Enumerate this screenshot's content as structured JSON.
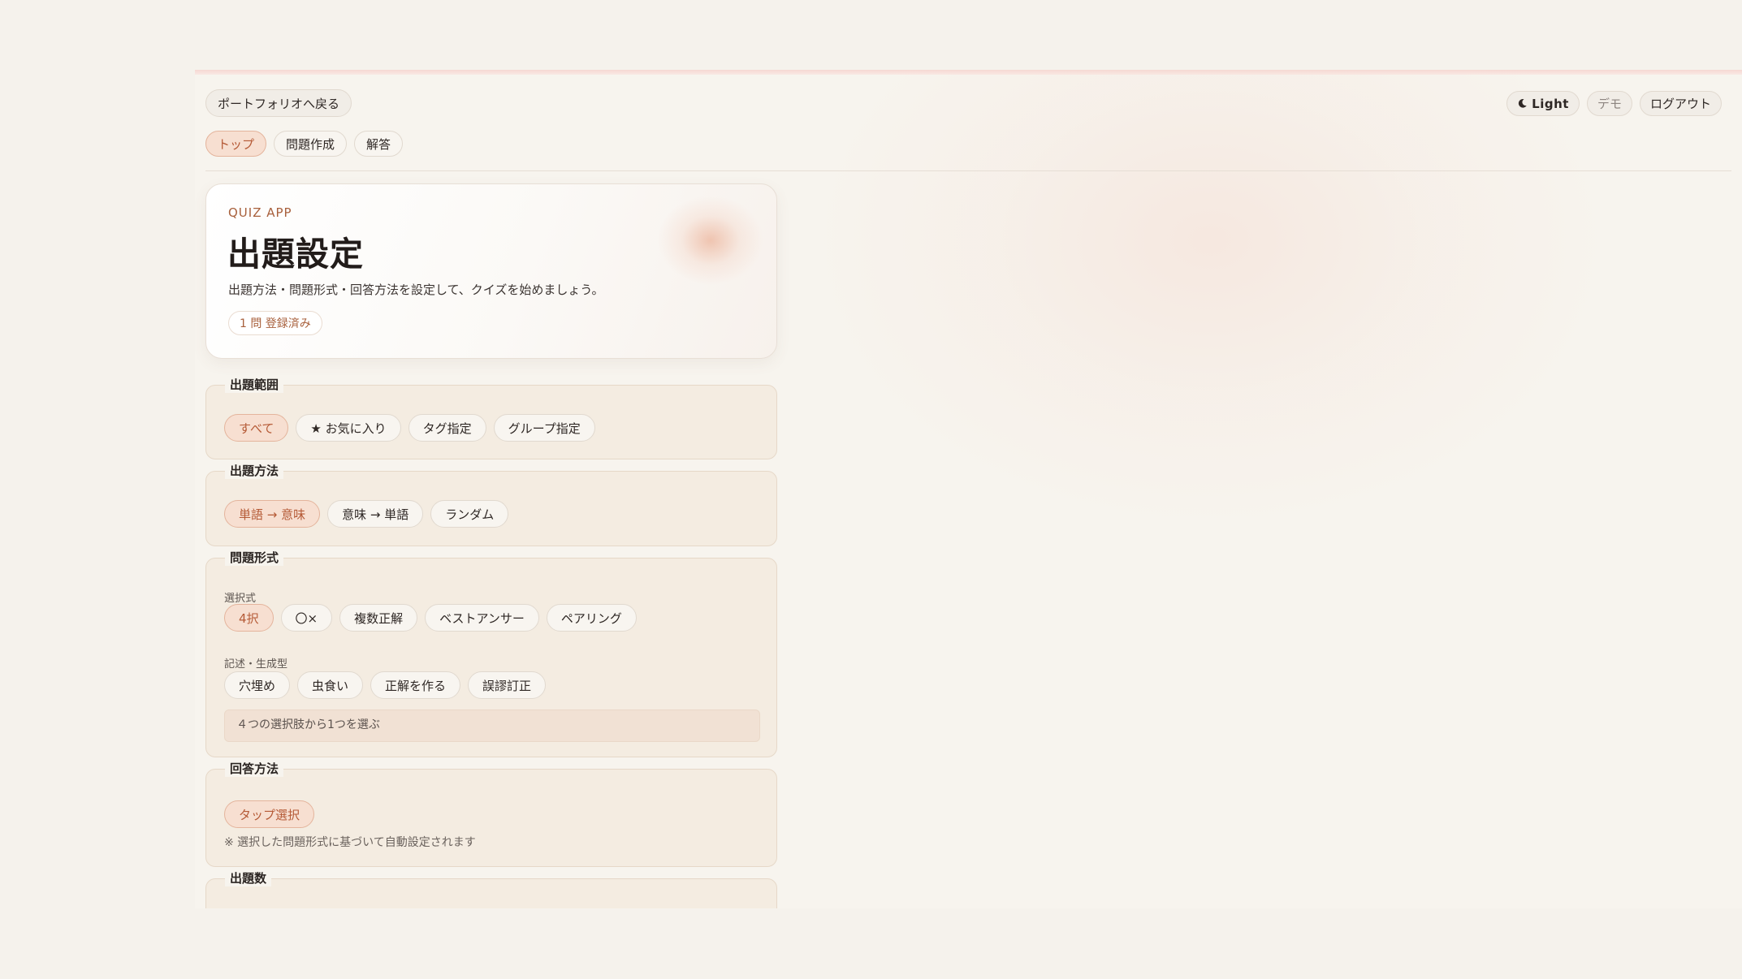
{
  "header": {
    "back_label": "ポートフォリオへ戻る",
    "theme_label": "Light",
    "theme_icon": "moon-icon",
    "demo_label": "デモ",
    "logout_label": "ログアウト"
  },
  "nav": {
    "tabs": [
      {
        "label": "トップ",
        "active": true
      },
      {
        "label": "問題作成",
        "active": false
      },
      {
        "label": "解答",
        "active": false
      }
    ]
  },
  "hero": {
    "eyebrow": "QUIZ APP",
    "title": "出題設定",
    "description": "出題方法・問題形式・回答方法を設定して、クイズを始めましょう。",
    "count_badge": "1 問 登録済み"
  },
  "scope": {
    "legend": "出題範囲",
    "options": [
      {
        "label": "すべて",
        "active": true
      },
      {
        "label": "★ お気に入り",
        "active": false
      },
      {
        "label": "タグ指定",
        "active": false
      },
      {
        "label": "グループ指定",
        "active": false
      }
    ]
  },
  "method": {
    "legend": "出題方法",
    "options": [
      {
        "label": "単語 → 意味",
        "active": true
      },
      {
        "label": "意味 → 単語",
        "active": false
      },
      {
        "label": "ランダム",
        "active": false
      }
    ]
  },
  "format": {
    "legend": "問題形式",
    "choice_label": "選択式",
    "choice_options": [
      {
        "label": "4択",
        "active": true
      },
      {
        "label": "〇×",
        "active": false
      },
      {
        "label": "複数正解",
        "active": false
      },
      {
        "label": "ベストアンサー",
        "active": false
      },
      {
        "label": "ペアリング",
        "active": false
      }
    ],
    "written_label": "記述・生成型",
    "written_options": [
      {
        "label": "穴埋め",
        "active": false
      },
      {
        "label": "虫食い",
        "active": false
      },
      {
        "label": "正解を作る",
        "active": false
      },
      {
        "label": "誤謬訂正",
        "active": false
      }
    ],
    "description": "４つの選択肢から1つを選ぶ"
  },
  "answer": {
    "legend": "回答方法",
    "options": [
      {
        "label": "タップ選択",
        "active": true
      }
    ],
    "note": "※ 選択した問題形式に基づいて自動設定されます"
  },
  "count": {
    "legend": "出題数"
  },
  "colors": {
    "accent": "#b55a36",
    "accent_bg": "#f7dfd1",
    "page_bg": "#f7f4ee",
    "section_bg": "#f4ece1"
  }
}
